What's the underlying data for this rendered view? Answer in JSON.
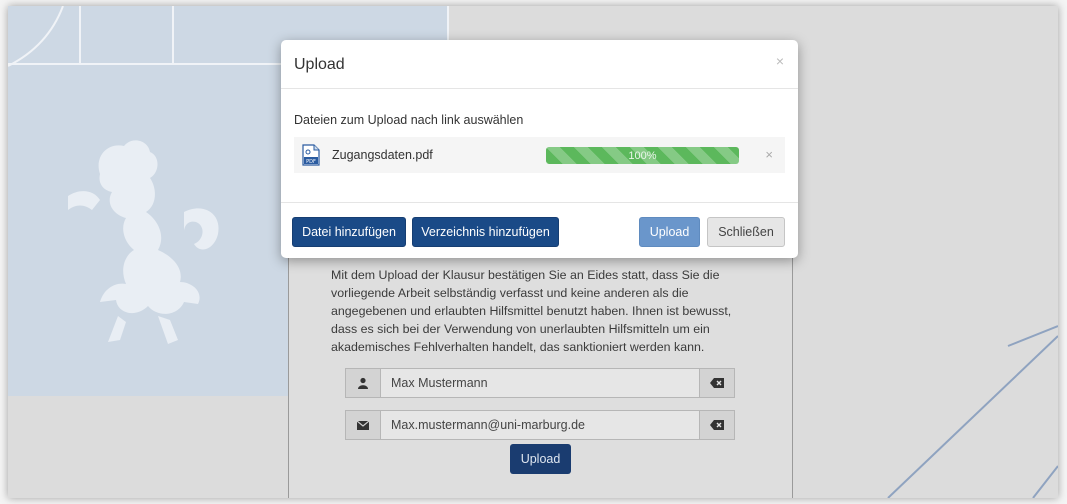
{
  "modal": {
    "title": "Upload",
    "close_symbol": "×",
    "select_label": "Dateien zum Upload nach link auswählen",
    "file": {
      "icon": "pdf-file-icon",
      "name": "Zugangsdaten.pdf",
      "progress": 100,
      "progress_label": "100%",
      "remove_symbol": "×"
    },
    "buttons": {
      "add_file": "Datei hinzufügen",
      "add_directory": "Verzeichnis hinzufügen",
      "upload": "Upload",
      "close": "Schließen"
    }
  },
  "form": {
    "declaration": "Mit dem Upload der Klausur bestätigen Sie an Eides statt, dass Sie die vorliegende Arbeit selbständig verfasst und keine anderen als die angegebenen und erlaubten Hilfsmittel benutzt haben. Ihnen ist bewusst, dass es sich bei der Verwendung von unerlaubten Hilfsmitteln um ein akademisches Fehlverhalten handelt, das sanktioniert werden kann.",
    "name_value": "Max Mustermann",
    "email_value": "Max.mustermann@uni-marburg.de",
    "upload_button": "Upload",
    "icons": [
      "user-icon",
      "envelope-icon",
      "clear-icon"
    ]
  },
  "colors": {
    "primary": "#1a4a87",
    "upload_light": "#6a96cb",
    "progress_green": "#5cb85c",
    "backdrop": "#dcdcdc",
    "bg_panel_blue": "#cdd8e4"
  }
}
